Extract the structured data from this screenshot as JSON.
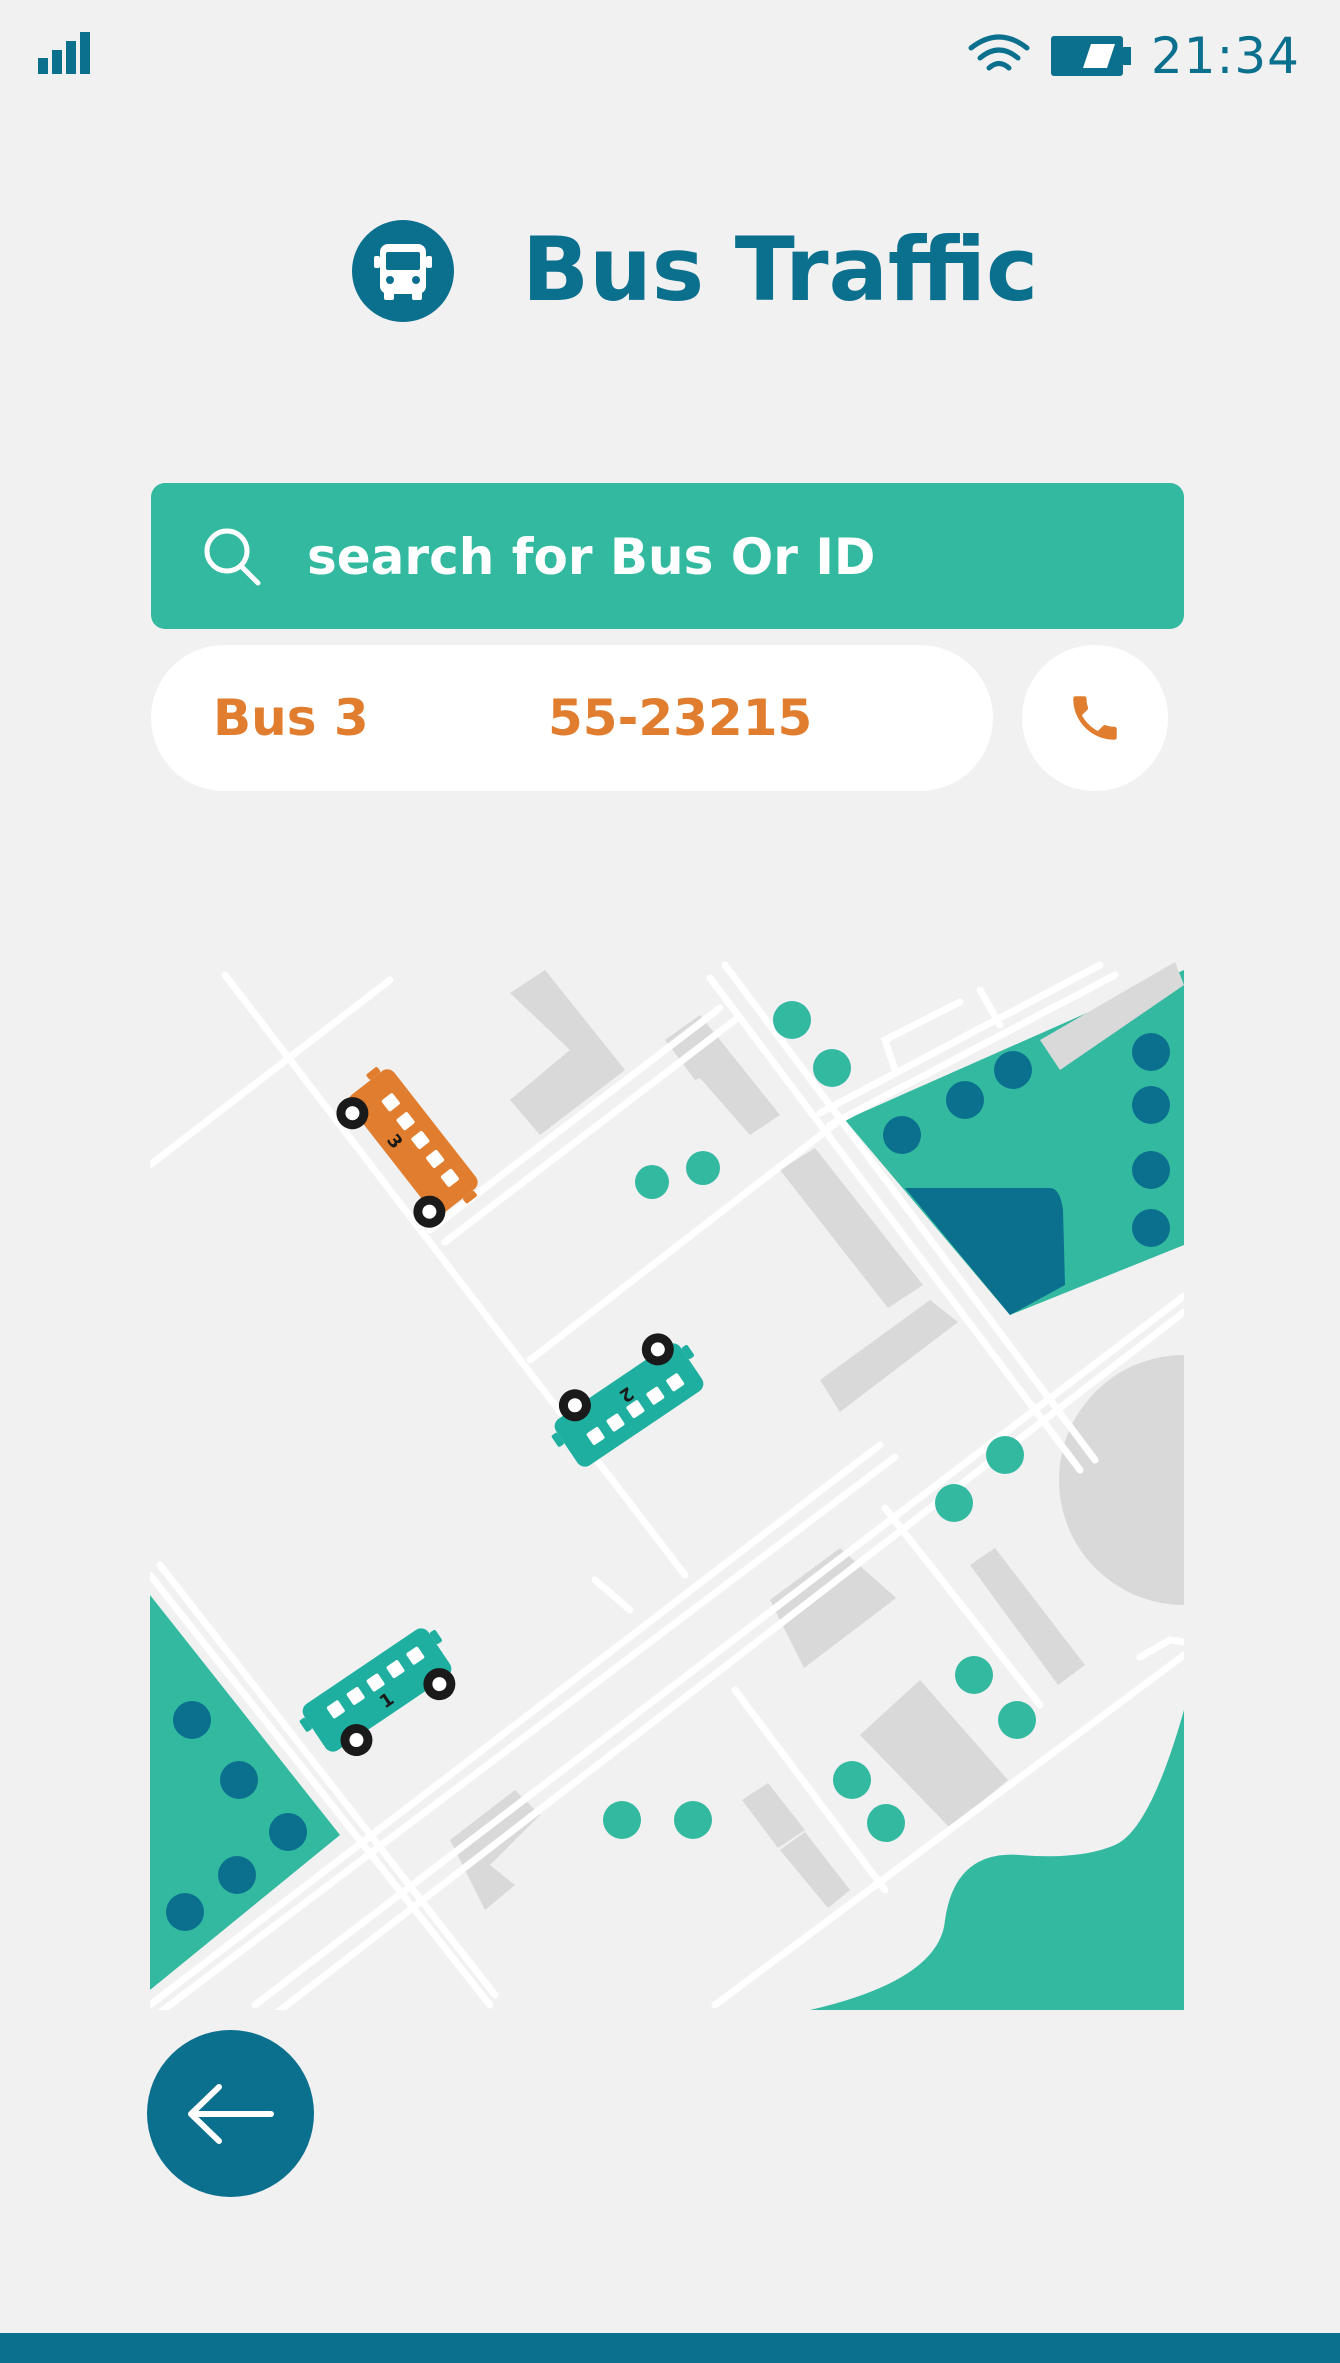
{
  "status": {
    "time": "21:34",
    "icons": [
      "signal-icon",
      "wifi-icon",
      "battery-icon"
    ]
  },
  "header": {
    "title": "Bus Traffic",
    "logo_icon": "bus-icon"
  },
  "search": {
    "placeholder": "search for Bus Or ID",
    "icon": "search-icon"
  },
  "result": {
    "bus": "Bus 3",
    "id": "55-23215",
    "call_icon": "phone-icon"
  },
  "map": {
    "buses": [
      {
        "number": "3",
        "color": "#e07d2e"
      },
      {
        "number": "2",
        "color": "#1fafa0"
      },
      {
        "number": "1",
        "color": "#1fafa0"
      }
    ]
  },
  "nav": {
    "back_icon": "arrow-left-icon"
  },
  "colors": {
    "primary": "#0b6f8e",
    "accent": "#33b9a0",
    "highlight": "#e07d2e",
    "background": "#f1f1f1"
  }
}
